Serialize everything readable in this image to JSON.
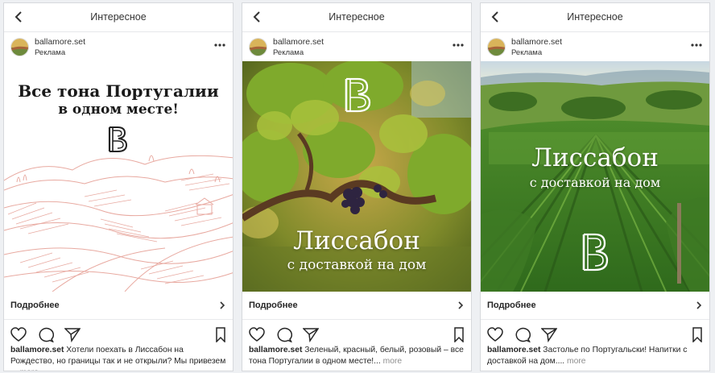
{
  "cards": [
    {
      "nav_title": "Интересное",
      "username": "ballamore.set",
      "sponsored": "Реклама",
      "headline_line1": "Все тона Португалии",
      "headline_line2": "в одном месте!",
      "cta": "Подробнее",
      "caption_user": "ballamore.set",
      "caption_text": " Хотели поехать в Лиссабон на Рождество, но границы так и не открыли? Мы привезем ...",
      "caption_more": "more"
    },
    {
      "nav_title": "Интересное",
      "username": "ballamore.set",
      "sponsored": "Реклама",
      "headline_line1": "Лиссабон",
      "headline_line2": "с доставкой на дом",
      "cta": "Подробнее",
      "caption_user": "ballamore.set",
      "caption_text": " Зеленый, красный, белый, розовый – все тона Португалии в одном месте!...",
      "caption_more": "more"
    },
    {
      "nav_title": "Интересное",
      "username": "ballamore.set",
      "sponsored": "Реклама",
      "headline_line1": "Лиссабон",
      "headline_line2": "с доставкой на дом",
      "cta": "Подробнее",
      "caption_user": "ballamore.set",
      "caption_text": " Застолье по Португальски! Напитки с доставкой на дом....",
      "caption_more": "more"
    }
  ],
  "icons": {
    "back": "chevron-left-icon",
    "more": "more-horizontal-icon",
    "cta_arrow": "chevron-right-icon",
    "like": "heart-icon",
    "comment": "comment-icon",
    "share": "send-icon",
    "save": "bookmark-icon",
    "logo": "b-brand-logo"
  },
  "colors": {
    "sketch": "#e8a9a0",
    "page_bg": "#eef0f3",
    "text": "#262626",
    "muted": "#8e8e8e"
  }
}
